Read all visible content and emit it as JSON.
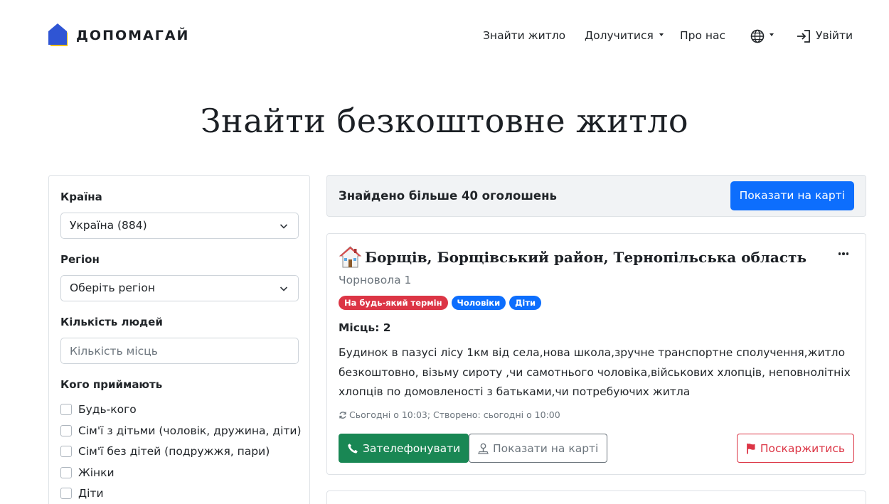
{
  "header": {
    "logo_text": "ДОПОМАГАЙ",
    "nav": {
      "find_housing": "Знайти житло",
      "join": "Долучитися",
      "about": "Про нас",
      "login": "Увійти"
    }
  },
  "page_title": "Знайти безкоштовне житло",
  "filters": {
    "country_label": "Країна",
    "country_value": "Україна (884)",
    "region_label": "Регіон",
    "region_value": "Оберіть регіон",
    "people_label": "Кількість людей",
    "people_placeholder": "Кількість місць",
    "accept_label": "Кого приймають",
    "accept_options": [
      "Будь-кого",
      "Сім'ї з дітьми (чоловік, дружина, діти)",
      "Сім'ї без дітей (подружжя, пари)",
      "Жінки",
      "Діти"
    ]
  },
  "results": {
    "count_text": "Знайдено більше 40 оголошень",
    "show_map_label": "Показати на карті"
  },
  "listing": {
    "title": "Борщів, Борщівський район, Тернопільська область",
    "address": "Чорновола 1",
    "badges": [
      {
        "label": "На будь-який термін",
        "color": "#dc3545"
      },
      {
        "label": "Чоловіки",
        "color": "#0d6efd"
      },
      {
        "label": "Діти",
        "color": "#0d6efd"
      }
    ],
    "places": "Місць: 2",
    "description": "Будинок в пазусі лісу 1км від села,нова школа,зручне транспортне сполучення,житло безкоштовно, візьму сироту ,чи самотнього чоловіка,військових хлопців, неповнолітніх хлопців по домовленості з батьками,чи потребуючих житла",
    "meta": "Сьогодні о 10:03; Створено: сьогодні о 10:00",
    "call_label": "Зателефонувати",
    "map_label": "Показати на карті",
    "report_label": "Поскаржитись"
  },
  "colors": {
    "primary": "#0d6efd",
    "success": "#198754",
    "danger": "#dc3545",
    "logo_blue": "#2f55d4",
    "logo_yellow": "#f2c200"
  }
}
